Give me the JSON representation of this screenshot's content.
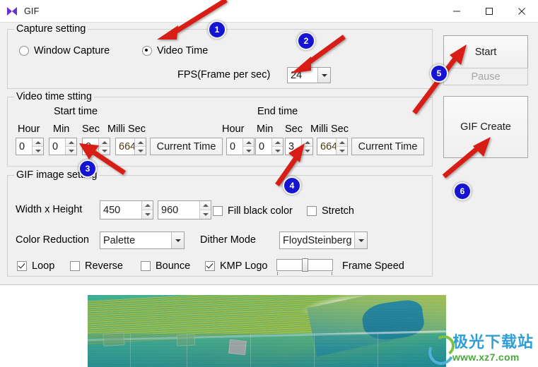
{
  "window": {
    "title": "GIF",
    "icon": "kmplayer-logo-icon",
    "minimize": "—",
    "maximize": "□",
    "close": "✕"
  },
  "capture_setting": {
    "group_title": "Capture setting",
    "window_capture": {
      "label": "Window Capture",
      "checked": false
    },
    "video_time": {
      "label": "Video Time",
      "checked": true
    },
    "fps_label": "FPS(Frame per sec)",
    "fps_value": "24"
  },
  "video_time_setting": {
    "group_title": "Video time stting",
    "start_time_label": "Start time",
    "end_time_label": "End time",
    "col_hour": "Hour",
    "col_min": "Min",
    "col_sec": "Sec",
    "col_milli": "Milli Sec",
    "start": {
      "hour": "0",
      "min": "0",
      "sec": "0",
      "milli": "664",
      "current_time": "Current Time"
    },
    "end": {
      "hour": "0",
      "min": "0",
      "sec": "3",
      "milli": "664",
      "current_time": "Current Time"
    }
  },
  "gif_image_setting": {
    "group_title": "GIF image setting",
    "size_label": "Width x Height",
    "width": "450",
    "height": "960",
    "fill_black": {
      "label": "Fill black color",
      "checked": false
    },
    "stretch": {
      "label": "Stretch",
      "checked": false
    },
    "color_reduction_label": "Color Reduction",
    "color_reduction_value": "Palette",
    "dither_mode_label": "Dither Mode",
    "dither_mode_value": "FloydSteinberg",
    "loop": {
      "label": "Loop",
      "checked": true
    },
    "reverse": {
      "label": "Reverse",
      "checked": false
    },
    "bounce": {
      "label": "Bounce",
      "checked": false
    },
    "kmp_logo": {
      "label": "KMP Logo",
      "checked": true
    },
    "frame_speed_label": "Frame Speed"
  },
  "actions": {
    "start": "Start",
    "pause": "Pause",
    "gif_create": "GIF Create"
  },
  "annotations": {
    "badges": [
      {
        "num": "1"
      },
      {
        "num": "2"
      },
      {
        "num": "3"
      },
      {
        "num": "4"
      },
      {
        "num": "5"
      },
      {
        "num": "6"
      }
    ],
    "arrow_color": "#d81f14",
    "badge_color": "#1414d2"
  },
  "watermark": {
    "brand": "极光下载站",
    "url": "www.xz7.com"
  }
}
